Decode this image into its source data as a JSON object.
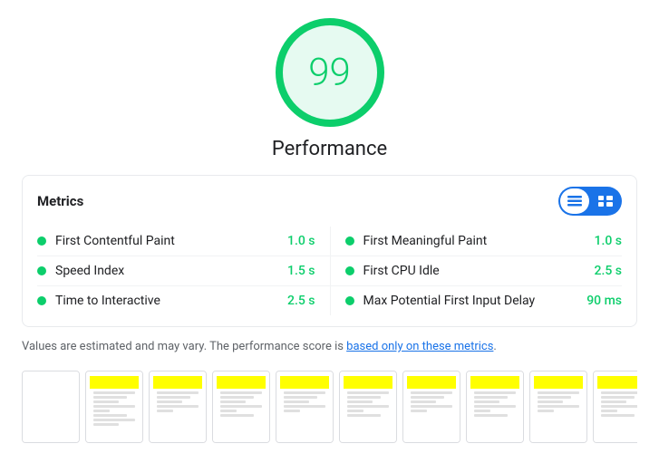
{
  "score": {
    "value": "99",
    "label": "Performance"
  },
  "metrics_header": {
    "title": "Metrics",
    "toggle_list_label": "list view",
    "toggle_grid_label": "grid view"
  },
  "metrics": {
    "left": [
      {
        "name": "First Contentful Paint",
        "value": "1.0 s"
      },
      {
        "name": "Speed Index",
        "value": "1.5 s"
      },
      {
        "name": "Time to Interactive",
        "value": "2.5 s"
      }
    ],
    "right": [
      {
        "name": "First Meaningful Paint",
        "value": "1.0 s"
      },
      {
        "name": "First CPU Idle",
        "value": "2.5 s"
      },
      {
        "name": "Max Potential First Input Delay",
        "value": "90 ms"
      }
    ]
  },
  "disclaimer": {
    "text_before": "Values are estimated and may vary. The performance score is ",
    "link_text": "based only on these metrics",
    "text_after": "."
  },
  "filmstrip": {
    "frames": [
      0,
      1,
      2,
      3,
      4,
      5,
      6,
      7,
      8,
      9,
      10
    ]
  }
}
